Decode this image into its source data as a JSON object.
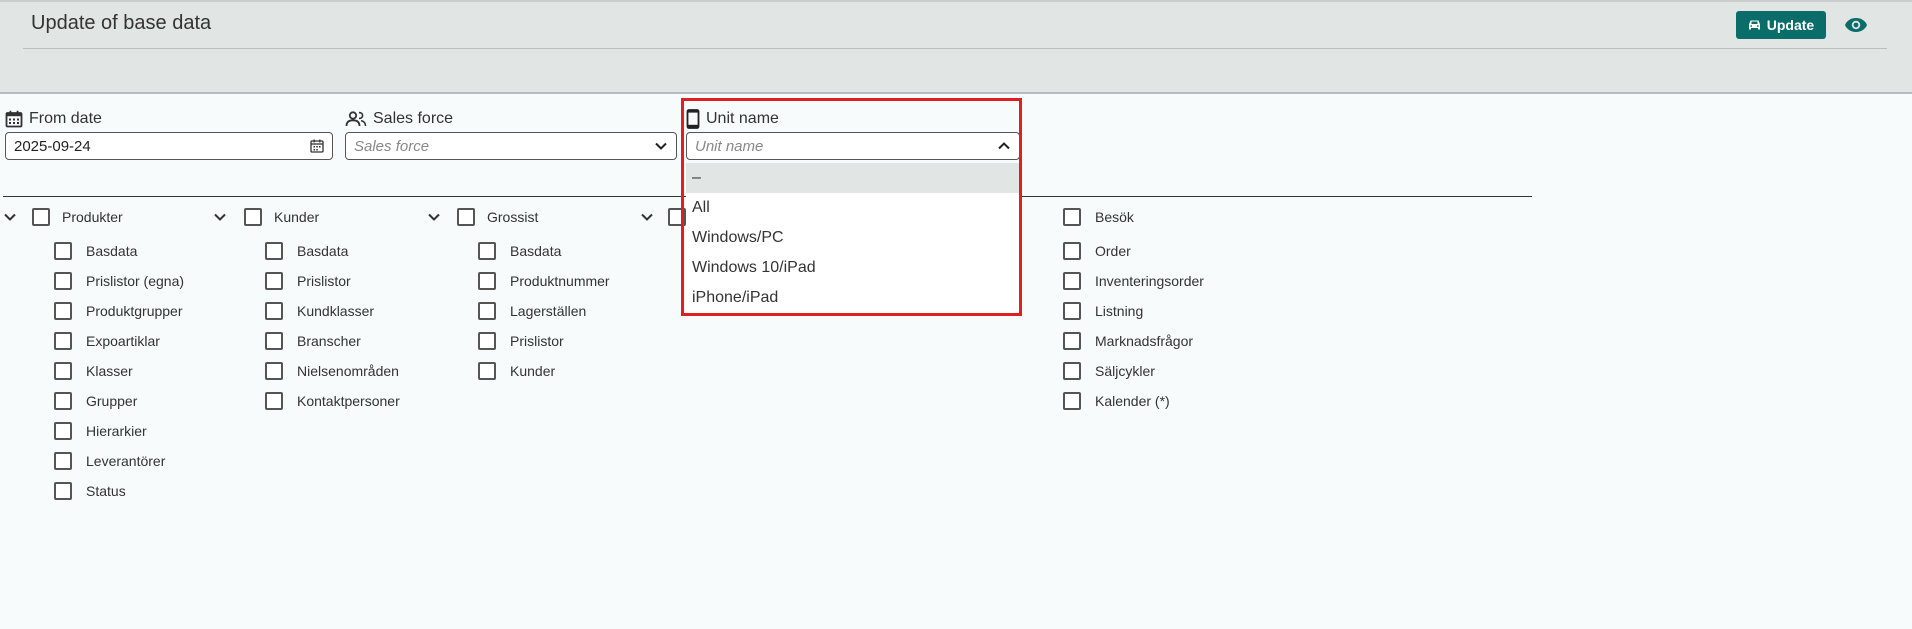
{
  "header": {
    "title": "Update of base data",
    "update_label": "Update",
    "update_icon": "car-icon",
    "view_icon": "eye-icon"
  },
  "filters": {
    "from_date": {
      "label": "From date",
      "value": "2025-09-24",
      "icon": "calendar-icon"
    },
    "sales_force": {
      "label": "Sales force",
      "placeholder": "Sales force",
      "icon": "people-icon"
    },
    "unit_name": {
      "label": "Unit name",
      "placeholder": "Unit name",
      "icon": "phone-icon"
    }
  },
  "unit_dropdown": {
    "options": [
      "–",
      "All",
      "Windows/PC",
      "Windows 10/iPad",
      "iPhone/iPad"
    ],
    "selected_index": 0
  },
  "groups": [
    {
      "title": "Produkter",
      "items": [
        "Basdata",
        "Prislistor (egna)",
        "Produktgrupper",
        "Expoartiklar",
        "Klasser",
        "Grupper",
        "Hierarkier",
        "Leverantörer",
        "Status"
      ]
    },
    {
      "title": "Kunder",
      "items": [
        "Basdata",
        "Prislistor",
        "Kundklasser",
        "Branscher",
        "Nielsenområden",
        "Kontaktpersoner"
      ]
    },
    {
      "title": "Grossist",
      "items": [
        "Basdata",
        "Produktnummer",
        "Lagerställen",
        "Prislistor",
        "Kunder"
      ]
    },
    {
      "title": "",
      "items": []
    },
    {
      "title": "Besök",
      "items": [
        "Order",
        "Inventeringsorder",
        "Listning",
        "Marknadsfrågor",
        "Säljcykler",
        "Kalender (*)"
      ]
    }
  ],
  "colors": {
    "accent": "#0b6d6a",
    "highlight_box": "#e02020",
    "header_bg": "#e1e5e4"
  }
}
